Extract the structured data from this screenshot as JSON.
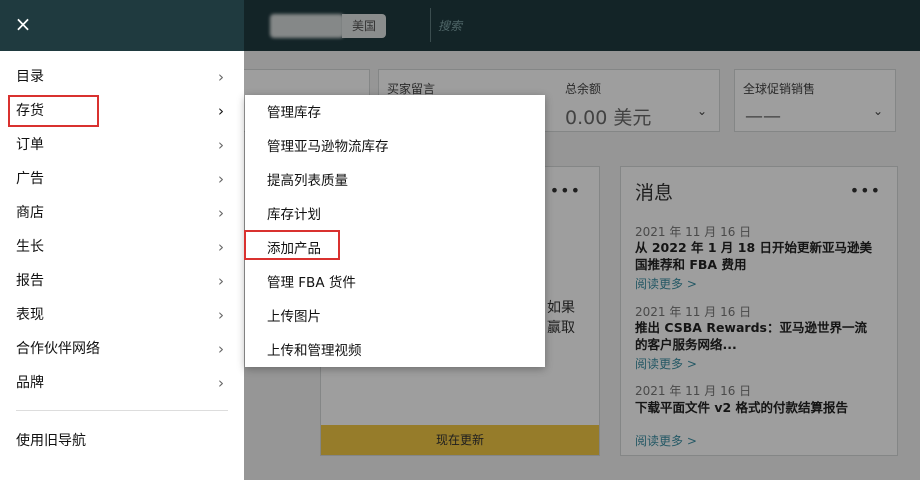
{
  "header": {
    "region": "美国",
    "search_placeholder": "搜索"
  },
  "dashboard": {
    "cards": [
      {
        "label": "买家留言",
        "value": ""
      },
      {
        "label": "总余额",
        "value": "0.00 美元"
      },
      {
        "label": "全球促销销售",
        "value": "——"
      }
    ],
    "left_card_partial_lines": [
      "如果",
      "赢取"
    ],
    "left_card_button": "现在更新",
    "messages": {
      "title": "消息",
      "items": [
        {
          "date": "2021 年 11 月 16 日",
          "headline": "从 2022 年 1 月 18 日开始更新亚马逊美国推荐和 FBA 费用",
          "link": "阅读更多 >"
        },
        {
          "date": "2021 年 11 月 16 日",
          "headline": "推出 CSBA Rewards：亚马逊世界一流的客户服务网络...",
          "link": "阅读更多 >"
        },
        {
          "date": "2021 年 11 月 16 日",
          "headline": "下载平面文件 v2 格式的付款结算报告",
          "link": "阅读更多 >"
        }
      ]
    }
  },
  "drawer": {
    "close_icon": "×",
    "chevron_icon": "›",
    "items": [
      {
        "label": "目录"
      },
      {
        "label": "存货"
      },
      {
        "label": "订单"
      },
      {
        "label": "广告"
      },
      {
        "label": "商店"
      },
      {
        "label": "生长"
      },
      {
        "label": "报告"
      },
      {
        "label": "表现"
      },
      {
        "label": "合作伙伴网络"
      },
      {
        "label": "品牌"
      }
    ],
    "legacy_nav": "使用旧导航"
  },
  "flyout": {
    "items": [
      {
        "label": "管理库存"
      },
      {
        "label": "管理亚马逊物流库存"
      },
      {
        "label": "提高列表质量"
      },
      {
        "label": "库存计划"
      },
      {
        "label": "添加产品"
      },
      {
        "label": "管理 FBA 货件"
      },
      {
        "label": "上传图片"
      },
      {
        "label": "上传和管理视频"
      }
    ]
  },
  "colors": {
    "header_bg": "#1f3a3f",
    "highlight_border": "#d9312f",
    "yellow_button": "#f3c845",
    "link": "#3b8fa3"
  }
}
